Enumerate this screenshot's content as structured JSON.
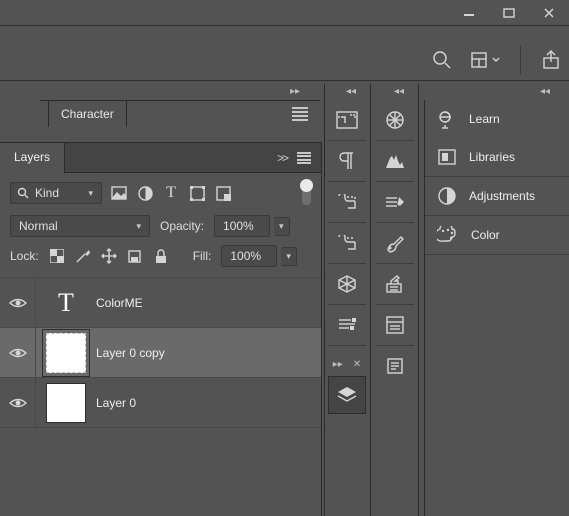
{
  "window": {
    "minimize": "—",
    "maximize": "▭",
    "close": "✕"
  },
  "toolbar": {
    "search_icon": "search-icon",
    "arrange_icon": "arrange-documents-icon",
    "share_icon": "share-icon"
  },
  "character": {
    "tab_label": "Character"
  },
  "layers": {
    "tab_label": "Layers",
    "expand": ">>",
    "filter": {
      "kind_label": "Kind",
      "icons": [
        "image-filter",
        "adjustment-filter",
        "type-filter",
        "shape-filter",
        "smartobject-filter"
      ]
    },
    "blend": {
      "mode": "Normal",
      "opacity_label": "Opacity:",
      "opacity_value": "100%"
    },
    "lock": {
      "label": "Lock:",
      "fill_label": "Fill:",
      "fill_value": "100%"
    },
    "items": [
      {
        "name": "ColorME",
        "type": "text",
        "visible": true,
        "selected": false
      },
      {
        "name": "Layer 0 copy",
        "type": "image",
        "visible": true,
        "selected": true
      },
      {
        "name": "Layer 0",
        "type": "image",
        "visible": true,
        "selected": false
      }
    ]
  },
  "stripA": [
    "glyphs",
    "paragraph",
    "styles",
    "swatches",
    "3d",
    "measure"
  ],
  "stripB": [
    "navigator",
    "histogram",
    "brushes",
    "brush-settings",
    "clone-source",
    "actions",
    "paths",
    "notes"
  ],
  "right": {
    "items": [
      {
        "icon": "learn",
        "label": "Learn"
      },
      {
        "icon": "libraries",
        "label": "Libraries"
      },
      {
        "icon": "adjustments",
        "label": "Adjustments"
      },
      {
        "icon": "color",
        "label": "Color"
      }
    ]
  }
}
